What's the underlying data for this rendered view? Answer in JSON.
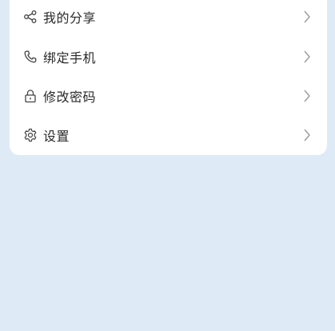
{
  "colors": {
    "page_background": "#deeaf6",
    "card_background": "#ffffff",
    "text": "#2a2a2a",
    "icon": "#444444",
    "chevron": "#9a9a9a"
  },
  "menu": {
    "items": [
      {
        "label": "我的分享",
        "icon": "share-icon"
      },
      {
        "label": "绑定手机",
        "icon": "phone-icon"
      },
      {
        "label": "修改密码",
        "icon": "lock-icon"
      },
      {
        "label": "设置",
        "icon": "gear-icon"
      }
    ]
  }
}
